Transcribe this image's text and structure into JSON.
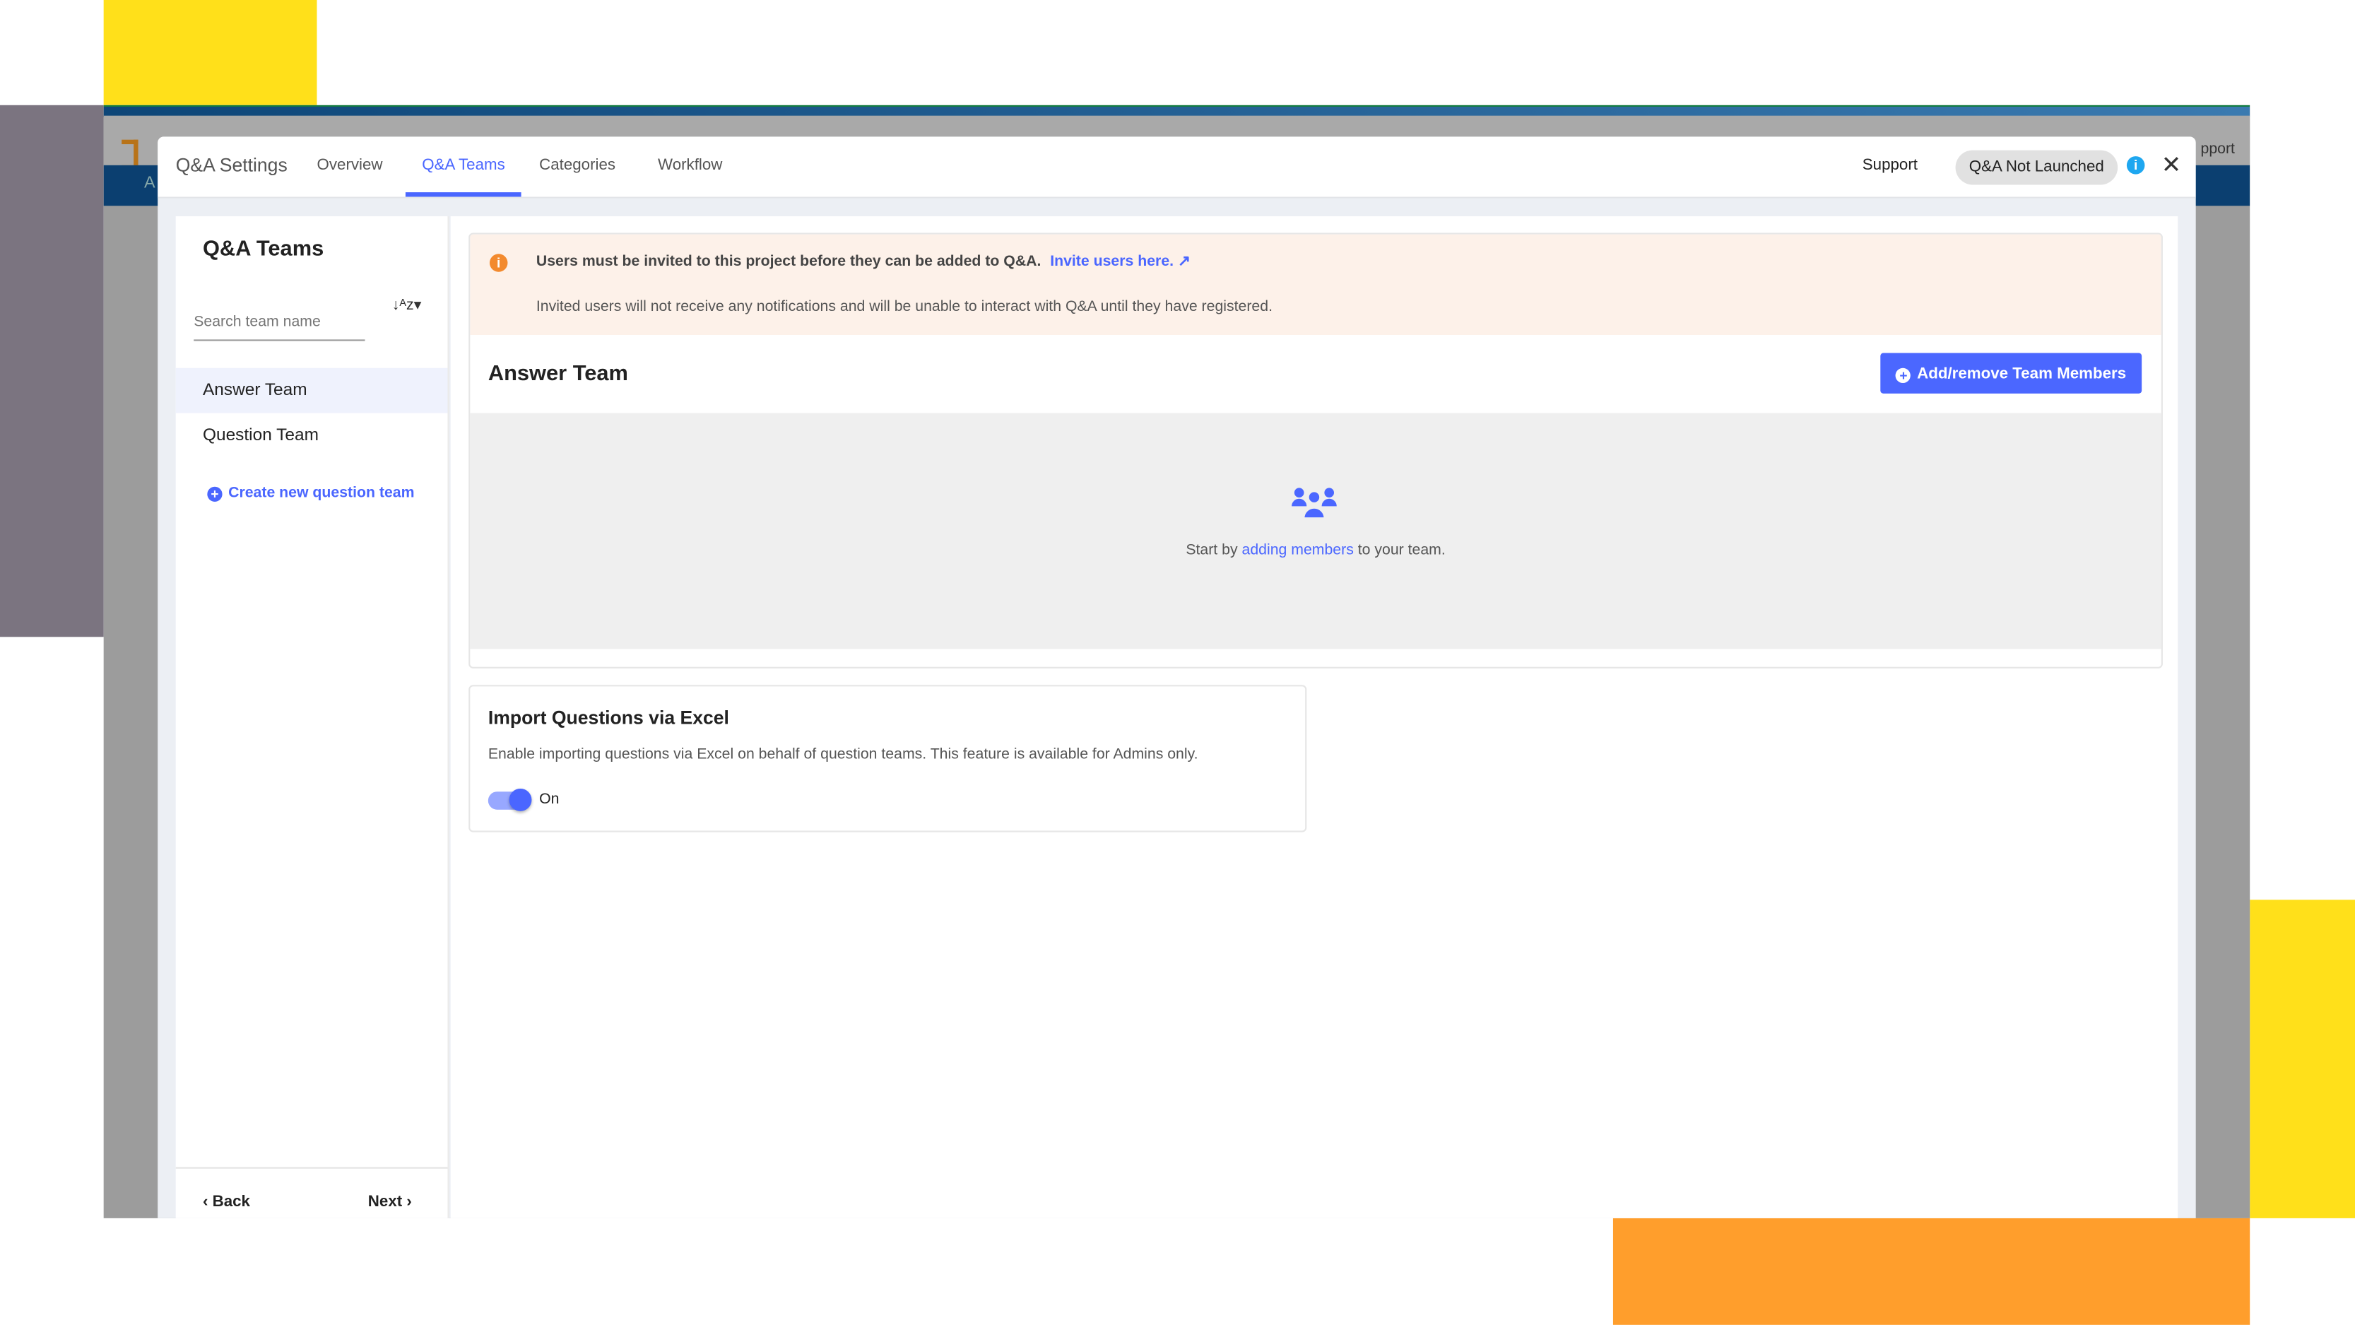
{
  "background_app": {
    "utility_visible": "pport",
    "nav_visible": "A"
  },
  "modal": {
    "title": "Q&A Settings",
    "tabs": [
      {
        "label": "Overview"
      },
      {
        "label": "Q&A Teams",
        "active": true
      },
      {
        "label": "Categories"
      },
      {
        "label": "Workflow"
      }
    ],
    "support_label": "Support",
    "status_badge": "Q&A Not Launched",
    "info_icon": "i",
    "close_icon": "✕"
  },
  "sidebar": {
    "title": "Q&A Teams",
    "search_placeholder": "Search team name",
    "sort_icon": "↓ᴬz▾",
    "teams": [
      {
        "label": "Answer Team",
        "selected": true
      },
      {
        "label": "Question Team"
      }
    ],
    "create_label": "Create new question team",
    "back_label": "Back",
    "next_label": "Next"
  },
  "alert": {
    "icon": "i",
    "line1": "Users must be invited to this project before they can be added to Q&A.",
    "link": "Invite users here.",
    "line2": "Invited users will not receive any notifications and will be unable to interact with Q&A until they have registered."
  },
  "team_panel": {
    "title": "Answer Team",
    "add_button": "Add/remove Team Members",
    "empty_prefix": "Start by ",
    "empty_link": "adding members",
    "empty_suffix": " to your team."
  },
  "import_card": {
    "title": "Import Questions via Excel",
    "description": "Enable importing questions via Excel on behalf of question teams. This feature is available for Admins only.",
    "toggle_on": true,
    "toggle_label": "On"
  },
  "colors": {
    "accent": "#4b67ff",
    "alert_bg": "#fdf1e9",
    "alert_icon": "#f38a2e",
    "info": "#1ea7f0"
  }
}
